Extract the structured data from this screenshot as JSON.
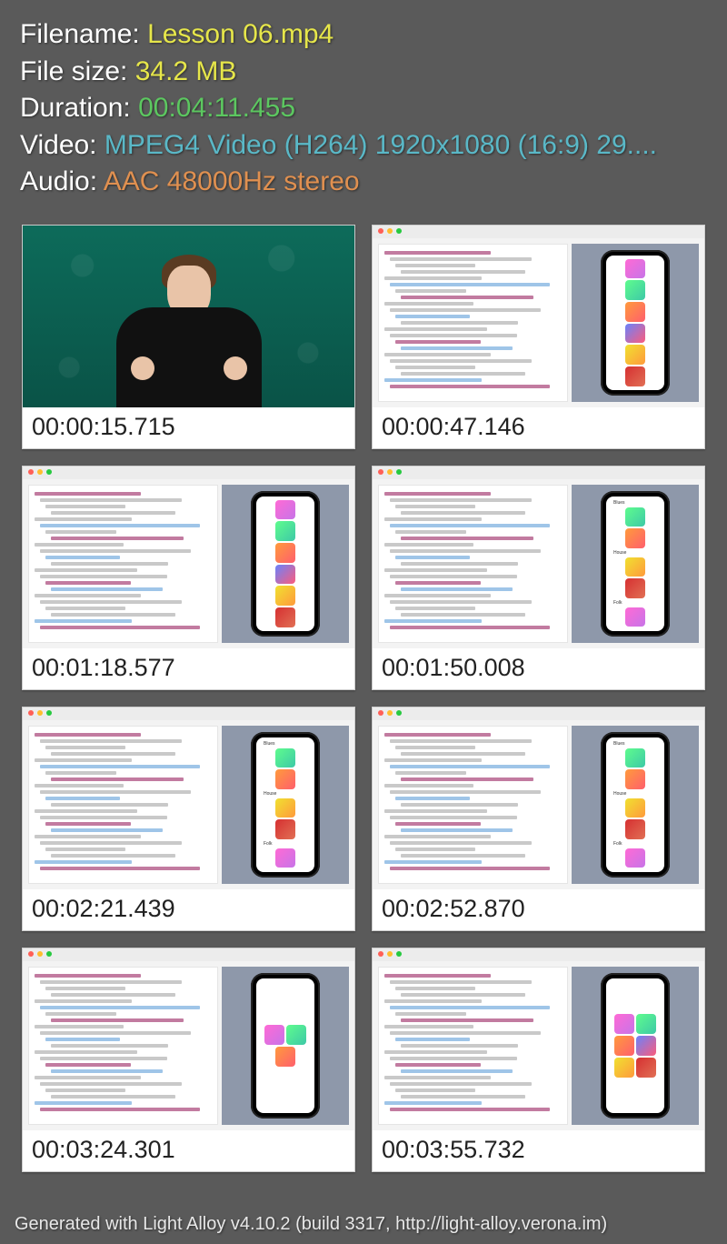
{
  "info": {
    "filename_label": "Filename: ",
    "filename_value": "Lesson 06.mp4",
    "filesize_label": "File size: ",
    "filesize_value": "34.2 MB",
    "duration_label": "Duration: ",
    "duration_value": "00:04:11.455",
    "video_label": "Video: ",
    "video_value": "MPEG4 Video (H264) 1920x1080 (16:9) 29....",
    "audio_label": "Audio: ",
    "audio_value": "AAC 48000Hz stereo"
  },
  "thumbs": [
    {
      "ts": "00:00:15.715",
      "kind": "presenter"
    },
    {
      "ts": "00:00:47.146",
      "kind": "xcode-v"
    },
    {
      "ts": "00:01:18.577",
      "kind": "xcode-v"
    },
    {
      "ts": "00:01:50.008",
      "kind": "xcode-v-labels"
    },
    {
      "ts": "00:02:21.439",
      "kind": "xcode-v-labels"
    },
    {
      "ts": "00:02:52.870",
      "kind": "xcode-v-labels"
    },
    {
      "ts": "00:03:24.301",
      "kind": "xcode-h"
    },
    {
      "ts": "00:03:55.732",
      "kind": "xcode-h-grid"
    }
  ],
  "footer": "Generated with Light Alloy v4.10.2 (build 3317, http://light-alloy.verona.im)"
}
